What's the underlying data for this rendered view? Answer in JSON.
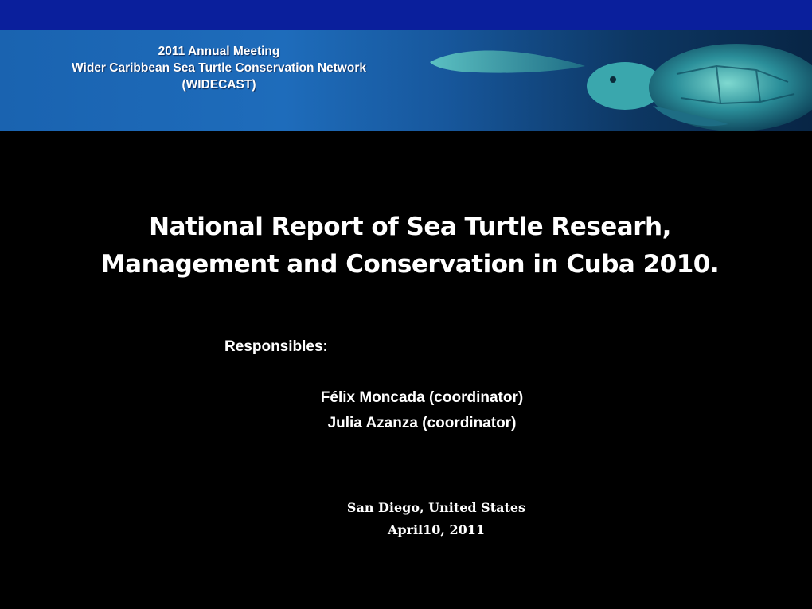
{
  "banner": {
    "meeting_line1": "2011 Annual Meeting",
    "meeting_line2": "Wider Caribbean Sea Turtle Conservation Network",
    "meeting_line3": "(WIDECAST)",
    "image_icon": "sea-turtle-photo"
  },
  "title": {
    "line1": "National Report of Sea Turtle Researh,",
    "line2": "Management and Conservation in Cuba 2010."
  },
  "responsibles": {
    "label": "Responsibles:",
    "person1": "Félix Moncada (coordinator)",
    "person2": "Julia Azanza (coordinator)"
  },
  "footer": {
    "place": "San Diego, United States",
    "date": "April10, 2011"
  },
  "colors": {
    "top_bar": "#0a1f9c",
    "banner_blue": "#1a63b0",
    "background": "#000000",
    "text": "#ffffff"
  }
}
